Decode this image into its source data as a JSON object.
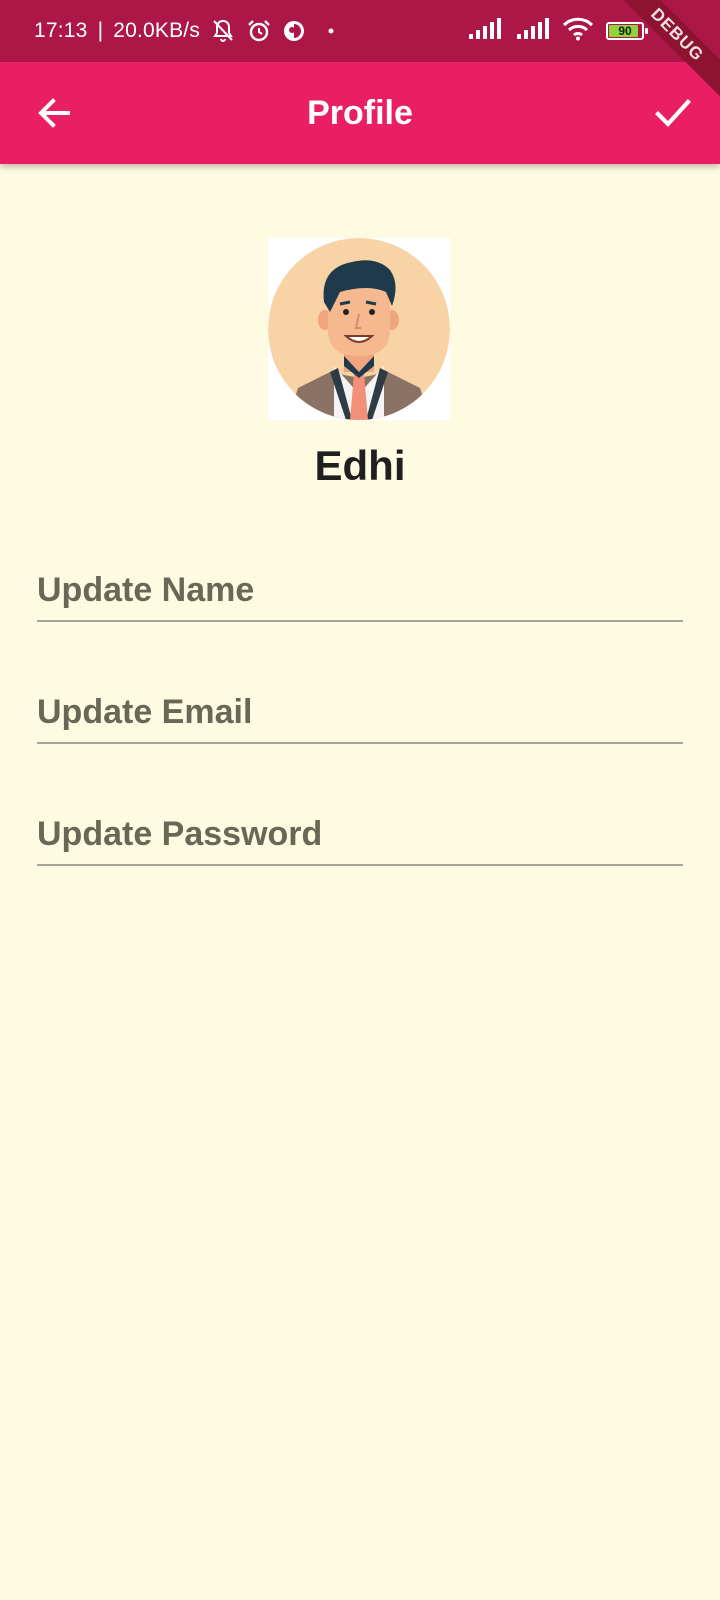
{
  "status_bar": {
    "time": "17:13",
    "separator": "|",
    "net_speed": "20.0KB/s",
    "battery_level": "90",
    "battery_fraction": 0.9,
    "battery_color": "#8bd43a",
    "icons": [
      "mute-bell-icon",
      "alarm-icon",
      "app-notification-icon",
      "dot-icon",
      "signal-icon",
      "signal-icon",
      "wifi-icon",
      "battery-icon"
    ]
  },
  "debug_banner": "DEBUG",
  "app_bar": {
    "title": "Profile",
    "background": "#e91e63",
    "back_icon": "arrow-back-icon",
    "save_icon": "check-icon"
  },
  "profile": {
    "name": "Edhi",
    "avatar_icon": "avatar-illustration"
  },
  "form": {
    "name_placeholder": "Update Name",
    "email_placeholder": "Update Email",
    "password_placeholder": "Update Password"
  },
  "colors": {
    "status_bar": "#ad1748",
    "page_background": "#fffbe3"
  }
}
